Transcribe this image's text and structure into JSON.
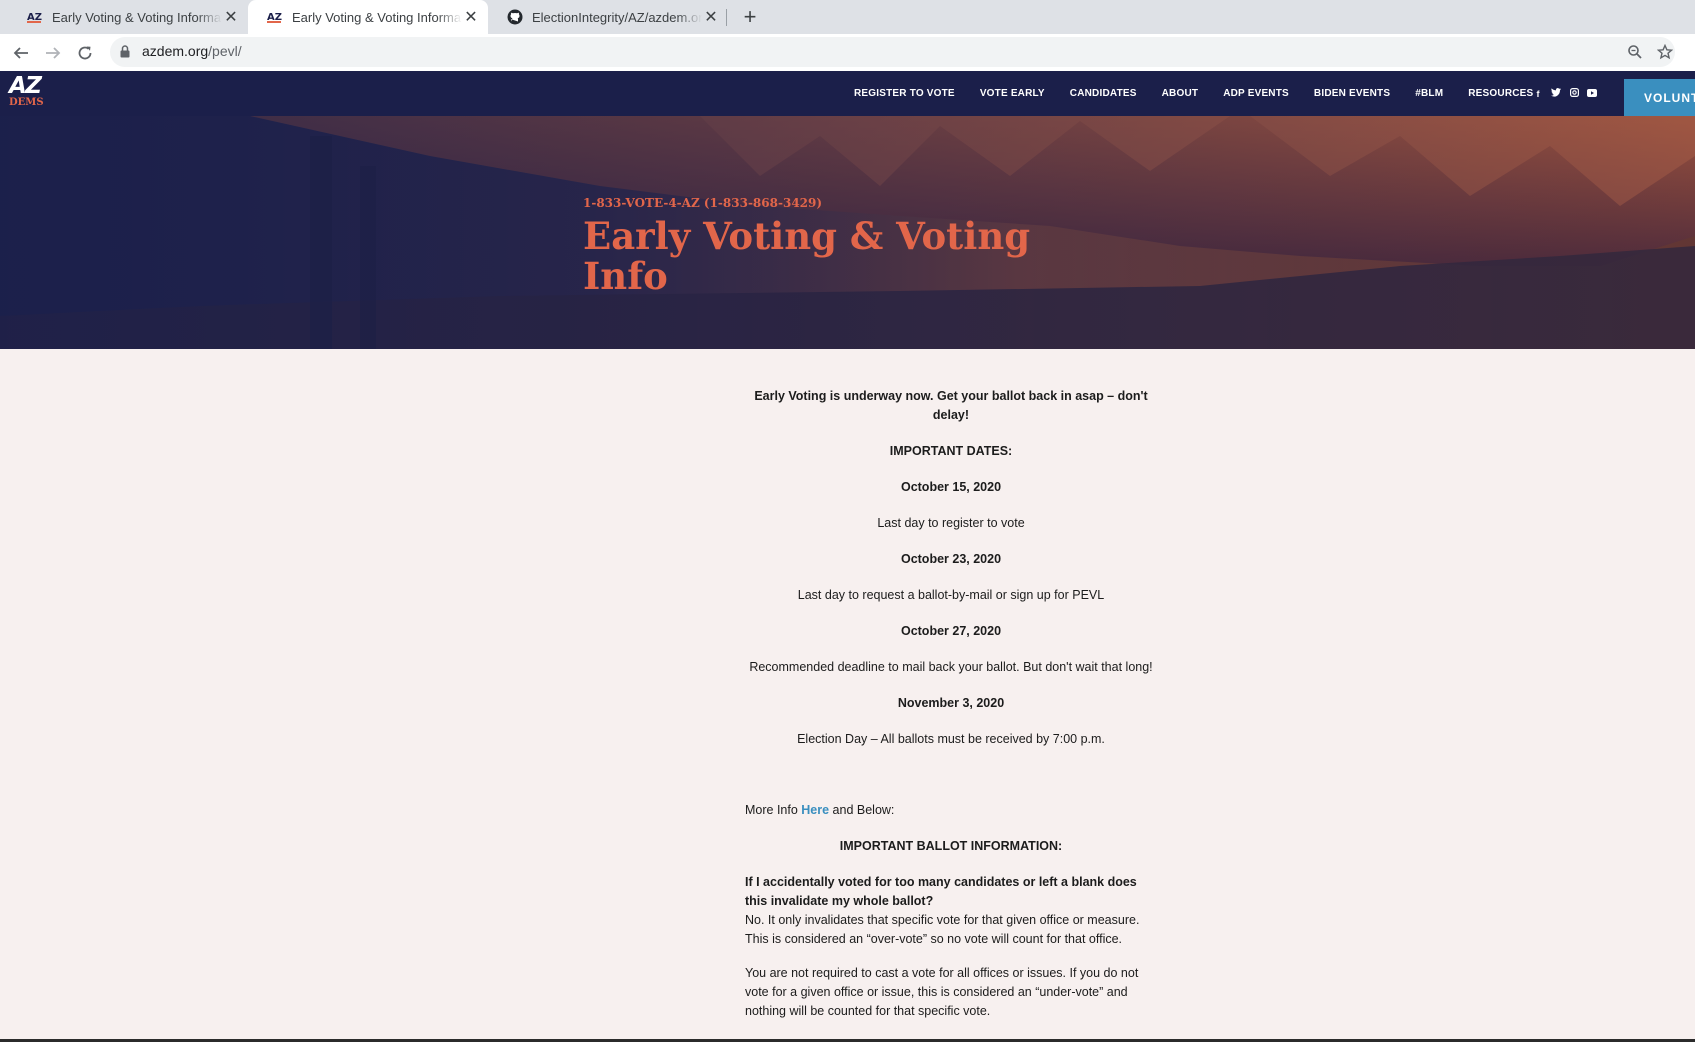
{
  "browser": {
    "tabs": [
      {
        "title": "Early Voting & Voting Information - Arizona Democratic Party",
        "favicon": "az-dems-favicon",
        "active": false
      },
      {
        "title": "Early Voting & Voting Information - Arizona Democratic Party",
        "favicon": "az-dems-favicon",
        "active": true
      },
      {
        "title": "ElectionIntegrity/AZ/azdem.org at main",
        "favicon": "github-icon",
        "active": false
      }
    ],
    "url_domain": "azdem.org",
    "url_path": "/pevl/"
  },
  "site": {
    "logo_top": "AZ",
    "logo_bottom": "DEMS",
    "nav": [
      "REGISTER TO VOTE",
      "VOTE EARLY",
      "CANDIDATES",
      "ABOUT",
      "ADP EVENTS",
      "BIDEN EVENTS",
      "#BLM",
      "RESOURCES"
    ],
    "social": [
      "facebook-icon",
      "twitter-icon",
      "instagram-icon",
      "youtube-icon"
    ],
    "volunteer_label": "VOLUNT",
    "colors": {
      "navy": "#1b1f4a",
      "accent": "#e2664a",
      "link": "#3a8fbf",
      "background": "#f7f0ef"
    }
  },
  "hero": {
    "phone": "1-833-VOTE-4-AZ (1-833-868-3429)",
    "title": "Early Voting & Voting Info"
  },
  "content": {
    "intro": "Early Voting is underway now. Get your ballot back in asap – don't delay!",
    "dates_heading": "IMPORTANT DATES:",
    "dates": [
      {
        "date": "October 15, 2020",
        "desc": "Last day to register to vote"
      },
      {
        "date": "October 23, 2020",
        "desc": "Last day to request a ballot-by-mail or sign up for PEVL"
      },
      {
        "date": "October 27, 2020",
        "desc": "Recommended deadline to mail back your ballot. But don't wait that long!"
      },
      {
        "date": "November 3, 2020",
        "desc": "Election Day – All ballots must be received by 7:00 p.m."
      }
    ],
    "more_info_prefix": "More Info ",
    "more_info_link": "Here",
    "more_info_suffix": " and Below:",
    "ballot_heading": "IMPORTANT BALLOT INFORMATION:",
    "faq_question": "If I accidentally voted for too many candidates or left a blank does this invalidate my whole ballot?",
    "faq_answer": "No. It only invalidates that specific vote for that given office or measure. This is considered an “over-vote” so no vote will count for that office.",
    "faq_paragraph2": "You are not required to cast a vote for all offices or issues. If you do not vote for a given office or issue, this is considered an “under-vote” and nothing will be counted for that specific vote."
  }
}
